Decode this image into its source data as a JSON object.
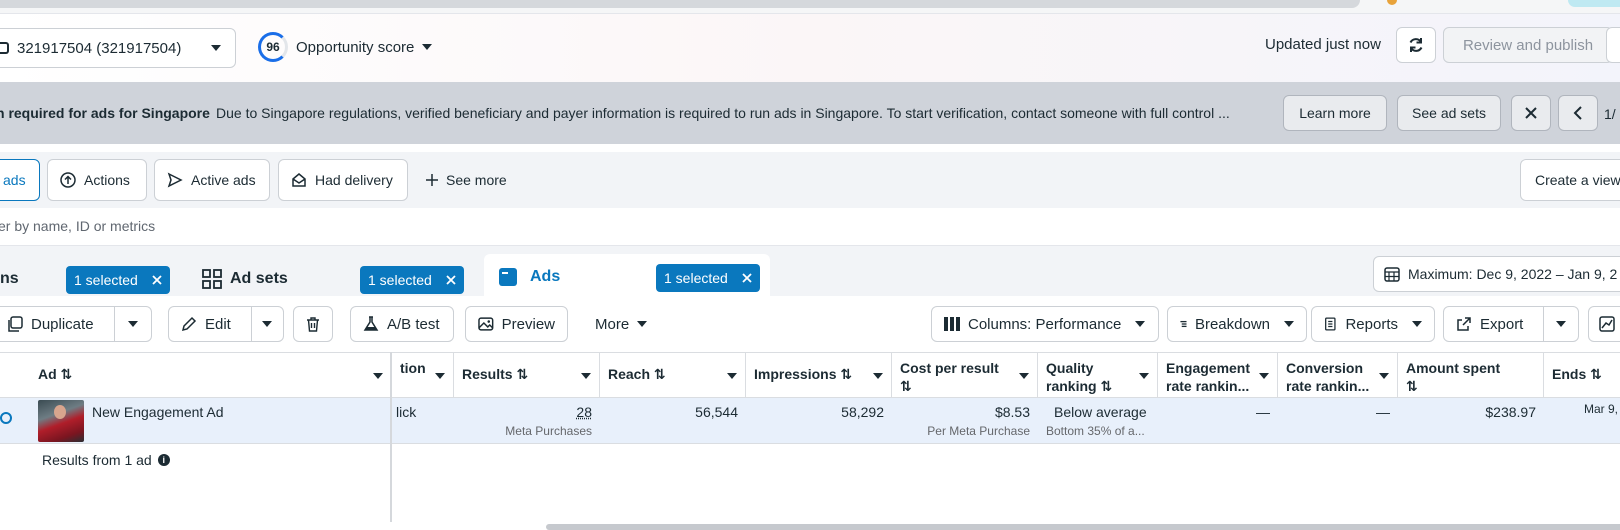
{
  "header": {
    "account": "321917504 (321917504)",
    "opportunity_score": "96",
    "opportunity_label": "Opportunity score",
    "updated": "Updated just now",
    "review_publish": "Review and publish"
  },
  "banner": {
    "title": "n required for ads for Singapore",
    "message": "Due to Singapore regulations, verified beneficiary and payer information is required to run ads in Singapore. To start verification, contact someone with full control ...",
    "learn_more": "Learn more",
    "see_ad_sets": "See ad sets",
    "pager": "1/"
  },
  "filters": {
    "chips": [
      "ads",
      "Actions",
      "Active ads",
      "Had delivery"
    ],
    "see_more": "See more",
    "create_view": "Create a view"
  },
  "search": {
    "placeholder": "er by name, ID or metrics"
  },
  "tabs": {
    "campaigns": {
      "label": "ns",
      "selected": "1 selected"
    },
    "adsets": {
      "label": "Ad sets",
      "selected": "1 selected"
    },
    "ads": {
      "label": "Ads",
      "selected": "1 selected"
    },
    "date_range": "Maximum: Dec 9, 2022 – Jan 9, 2"
  },
  "toolbar": {
    "duplicate": "Duplicate",
    "edit": "Edit",
    "ab_test": "A/B test",
    "preview": "Preview",
    "more": "More",
    "columns": "Columns: Performance",
    "breakdown": "Breakdown",
    "reports": "Reports",
    "export": "Export"
  },
  "table": {
    "columns": {
      "ad": "Ad ⇅",
      "attribution": "tion",
      "results": "Results ⇅",
      "reach": "Reach ⇅",
      "impressions": "Impressions ⇅",
      "cost_per_result_1": "Cost per result",
      "cost_per_result_2": "⇅",
      "quality_1": "Quality",
      "quality_2": "ranking ⇅",
      "engagement_1": "Engagement",
      "engagement_2": "rate rankin...",
      "conversion_1": "Conversion",
      "conversion_2": "rate rankin...",
      "amount_1": "Amount spent",
      "amount_2": "⇅",
      "ends": "Ends ⇅"
    },
    "row": {
      "name": "New Engagement Ad",
      "attribution": "lick",
      "results": "28",
      "results_sub": "Meta Purchases",
      "reach": "56,544",
      "impressions": "58,292",
      "cost": "$8.53",
      "cost_sub": "Per Meta Purchase",
      "quality": "Below average",
      "quality_sub": "Bottom 35% of a...",
      "engagement": "—",
      "conversion": "—",
      "amount": "$238.97",
      "ends": "Mar 9,"
    },
    "summary": "Results from 1 ad"
  },
  "colors": {
    "accent": "#0a78be",
    "banner_bg": "#cfd3da",
    "row_highlight": "#e8f0fb"
  }
}
